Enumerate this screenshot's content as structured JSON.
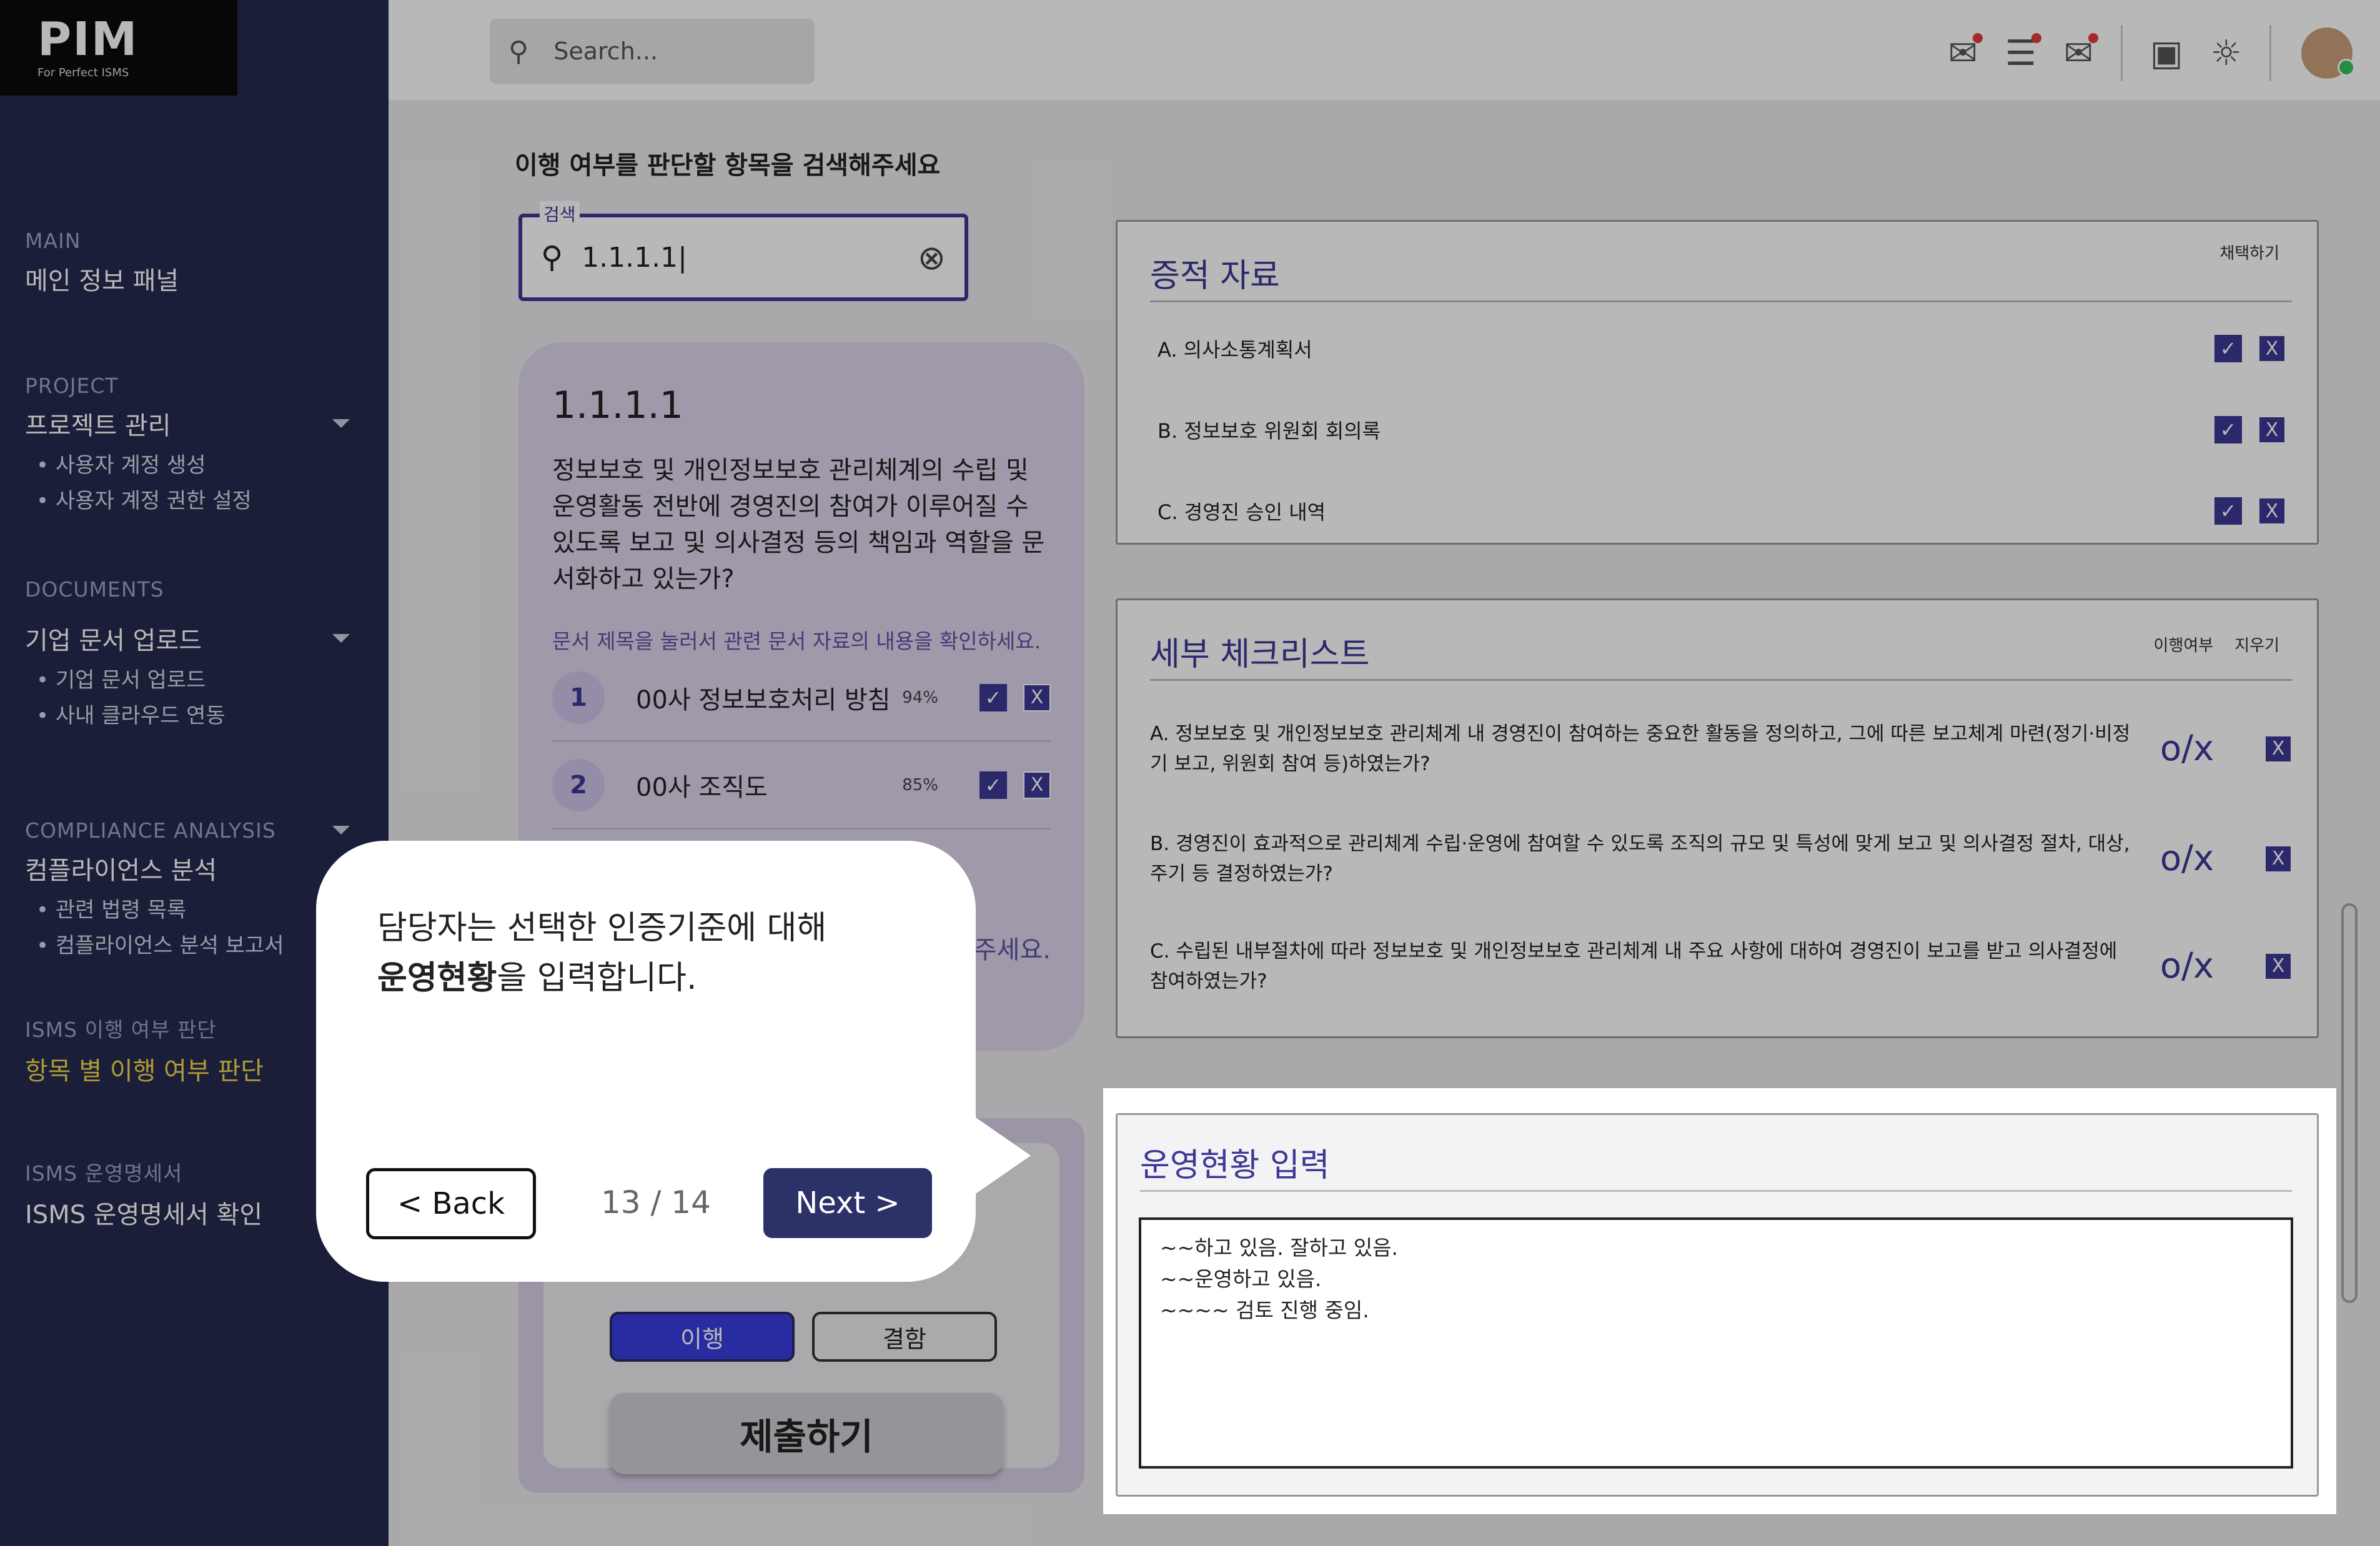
{
  "logo": {
    "main": "PIM",
    "sub": "For Perfect ISMS"
  },
  "sidebar": {
    "main": {
      "head": "MAIN",
      "title": "메인 정보 패널"
    },
    "project": {
      "head": "PROJECT",
      "title": "프로젝트 관리",
      "items": [
        "사용자 계정 생성",
        "사용자 계정 권한 설정"
      ]
    },
    "documents": {
      "head": "DOCUMENTS",
      "title": "기업 문서 업로드",
      "items": [
        "기업 문서 업로드",
        "사내 클라우드 연동"
      ]
    },
    "compliance": {
      "head": "COMPLIANCE ANALYSIS",
      "title": "컴플라이언스 분석",
      "items": [
        "관련 법령 목록",
        "컴플라이언스 분석 보고서"
      ]
    },
    "isms": {
      "head": "ISMS 이행 여부 판단",
      "title": "항목 별 이행 여부 판단"
    },
    "statement": {
      "head": "ISMS 운영명세서",
      "title": "ISMS 운영명세서 확인"
    }
  },
  "topbar": {
    "search_placeholder": "Search..."
  },
  "main": {
    "title": "이행 여부를 판단할 항목을 검색해주세요",
    "field_label": "검색",
    "field_value": "1.1.1.1|"
  },
  "card": {
    "no": "1.1.1.1",
    "question": "정보보호 및 개인정보보호 관리체계의 수립 및 운영활동 전반에 경영진의 참여가 이루어질 수 있도록 보고 및 의사결정 등의 책임과 역할을 문서화하고 있는가?",
    "hint": "문서 제목을 눌러서 관련 문서 자료의 내용을 확인하세요.",
    "docs": [
      {
        "no": "1",
        "name": "00사 정보보호처리 방침",
        "pct": "94%"
      },
      {
        "no": "2",
        "name": "00사 조직도",
        "pct": "85%"
      }
    ],
    "hint_tail": "주세요."
  },
  "actions": {
    "ok": "이행",
    "ng": "결함",
    "submit": "제출하기"
  },
  "evidence": {
    "title": "증적 자료",
    "header": "채택하기",
    "items": [
      "A.  의사소통계획서",
      "B. 정보보호 위원회 회의록",
      "C. 경영진 승인 내역"
    ]
  },
  "checklist": {
    "title": "세부 체크리스트",
    "header_a": "이행여부",
    "header_b": "지우기",
    "items": [
      {
        "text": "A.  정보보호 및 개인정보보호 관리체계 내 경영진이 참여하는 중요한 활동을 정의하고, 그에 따른 보고체계 마련(정기·비정기 보고, 위원회 참여 등)하였는가?",
        "ox": "o/x"
      },
      {
        "text": "B. 경영진이 효과적으로 관리체계 수립·운영에 참여할 수 있도록 조직의 규모 및 특성에 맞게 보고 및 의사결정 절차, 대상, 주기 등 결정하였는가?",
        "ox": "o/x"
      },
      {
        "text": "C. 수립된 내부절차에 따라 정보보호 및 개인정보보호 관리체계 내 주요 사항에 대하여 경영진이 보고를 받고 의사결정에 참여하였는가?",
        "ox": "o/x"
      }
    ]
  },
  "operation": {
    "title": "운영현황 입력",
    "lines": [
      "~~하고 있음. 잘하고 있음.",
      "~~운영하고 있음.",
      "~~~~ 검토 진행 중임."
    ]
  },
  "tour": {
    "line1": "담당자는 선택한 인증기준에 대해",
    "line2_bold": "운영현황",
    "line2_rest": "을 입력합니다.",
    "back": "< Back",
    "page": "13 / 14",
    "next": "Next >"
  }
}
